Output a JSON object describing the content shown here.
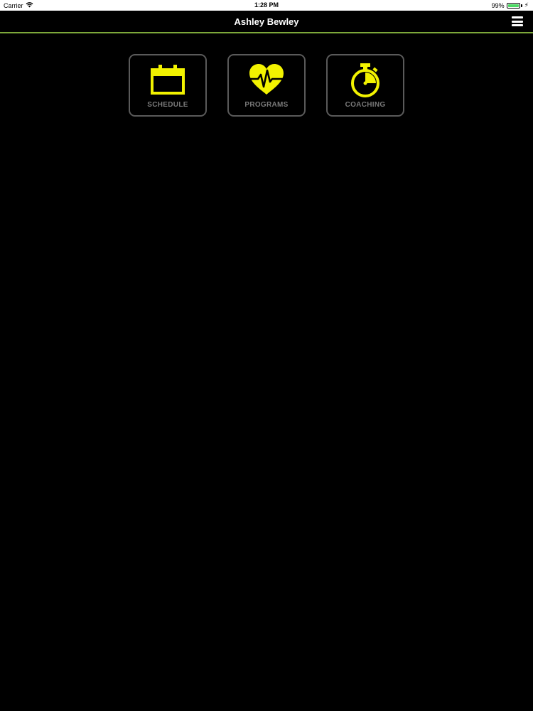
{
  "status_bar": {
    "carrier": "Carrier",
    "time": "1:28 PM",
    "battery_percent": "99%",
    "battery_level": 0.99,
    "wifi_icon": "wifi-icon",
    "battery_icon": "battery-icon"
  },
  "nav": {
    "title": "Ashley Bewley",
    "menu_icon": "hamburger-menu-icon"
  },
  "tiles": [
    {
      "label": "SCHEDULE",
      "icon": "calendar-icon"
    },
    {
      "label": "PROGRAMS",
      "icon": "heart-pulse-icon"
    },
    {
      "label": "COACHING",
      "icon": "stopwatch-icon"
    }
  ],
  "colors": {
    "background": "#000000",
    "accent_icon": "#f2f200",
    "nav_divider": "#7da83a",
    "tile_border": "#5a5a5a",
    "tile_label": "#7a7a7a",
    "battery_fill": "#4cd964"
  }
}
